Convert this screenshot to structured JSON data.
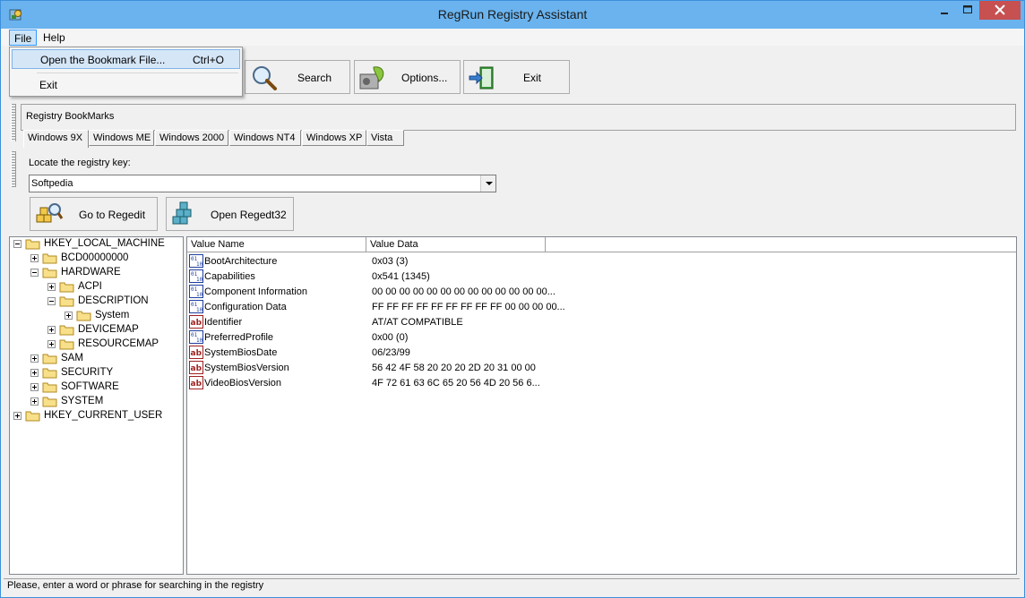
{
  "window": {
    "title": "RegRun Registry Assistant"
  },
  "menu": {
    "file": "File",
    "help": "Help"
  },
  "file_menu": {
    "open_label": "Open the Bookmark File...",
    "open_shortcut": "Ctrl+O",
    "exit_label": "Exit"
  },
  "toolbar": {
    "search": "Search",
    "options": "Options...",
    "exit": "Exit"
  },
  "bookmarks": {
    "title": "Registry BookMarks",
    "tabs": [
      "Windows 9X",
      "Windows ME",
      "Windows 2000",
      "Windows NT4",
      "Windows XP",
      "Vista"
    ],
    "active_tab": "Windows 9X"
  },
  "locate": {
    "label": "Locate the registry key:",
    "value": "Softpedia",
    "goto_regedit": "Go to Regedit",
    "open_regedt32": "Open Regedt32"
  },
  "tree": [
    {
      "label": "HKEY_LOCAL_MACHINE",
      "expanded": true,
      "level": 0
    },
    {
      "label": "BCD00000000",
      "expanded": false,
      "level": 1
    },
    {
      "label": "HARDWARE",
      "expanded": true,
      "level": 1
    },
    {
      "label": "ACPI",
      "expanded": false,
      "level": 2
    },
    {
      "label": "DESCRIPTION",
      "expanded": true,
      "level": 2
    },
    {
      "label": "System",
      "expanded": false,
      "level": 3
    },
    {
      "label": "DEVICEMAP",
      "expanded": false,
      "level": 2
    },
    {
      "label": "RESOURCEMAP",
      "expanded": false,
      "level": 2
    },
    {
      "label": "SAM",
      "expanded": false,
      "level": 1
    },
    {
      "label": "SECURITY",
      "expanded": false,
      "level": 1
    },
    {
      "label": "SOFTWARE",
      "expanded": false,
      "level": 1
    },
    {
      "label": "SYSTEM",
      "expanded": false,
      "level": 1
    },
    {
      "label": "HKEY_CURRENT_USER",
      "expanded": false,
      "level": 0
    }
  ],
  "list": {
    "columns": [
      "Value Name",
      "Value Data"
    ],
    "rows": [
      {
        "name": "BootArchitecture",
        "data": "0x03 (3)",
        "type": "binary-icon"
      },
      {
        "name": "Capabilities",
        "data": "0x541 (1345)",
        "type": "binary-icon"
      },
      {
        "name": "Component Information",
        "data": "00 00 00 00 00 00 00 00 00 00 00 00 00...",
        "type": "binary-icon"
      },
      {
        "name": "Configuration Data",
        "data": "FF FF FF FF FF FF FF FF FF 00 00 00 00...",
        "type": "binary-icon"
      },
      {
        "name": "Identifier",
        "data": "AT/AT COMPATIBLE",
        "type": "string-icon"
      },
      {
        "name": "PreferredProfile",
        "data": "0x00 (0)",
        "type": "binary-icon"
      },
      {
        "name": "SystemBiosDate",
        "data": "06/23/99",
        "type": "string-icon"
      },
      {
        "name": "SystemBiosVersion",
        "data": "56 42 4F 58 20 20 20 2D 20 31 00 00",
        "type": "string-icon"
      },
      {
        "name": "VideoBiosVersion",
        "data": "4F 72 61 63 6C 65 20 56 4D 20 56 6...",
        "type": "string-icon"
      }
    ]
  },
  "status": {
    "text": "Please, enter a word or phrase for searching in the registry"
  }
}
